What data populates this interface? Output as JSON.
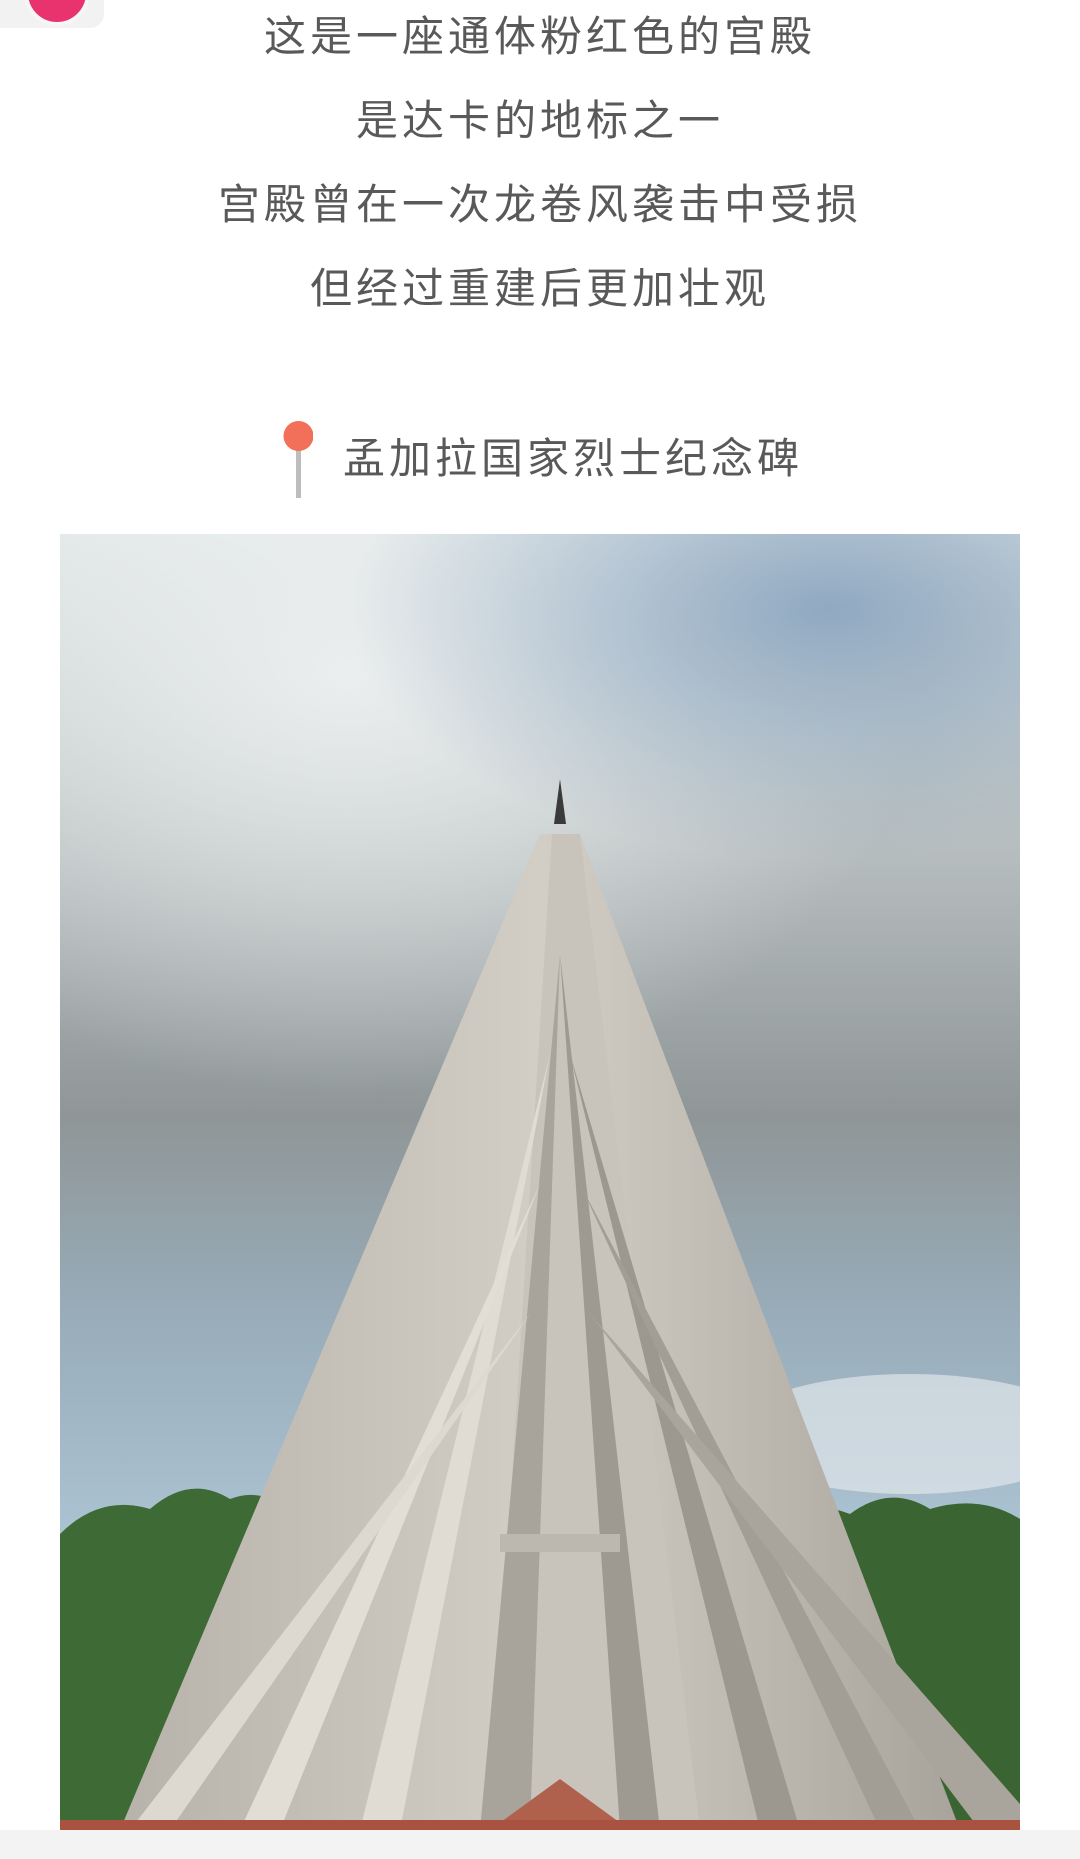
{
  "article": {
    "lines": [
      "这是一座通体粉红色的宫殿",
      "是达卡的地标之一",
      "宫殿曾在一次龙卷风袭击中受损",
      "但经过重建后更加壮观"
    ],
    "location_title": "孟加拉国家烈士纪念碑"
  },
  "colors": {
    "avatar": "#e8336e",
    "pin": "#f2705a",
    "text": "#595959"
  },
  "icons": {
    "location": "map-pin-icon"
  }
}
